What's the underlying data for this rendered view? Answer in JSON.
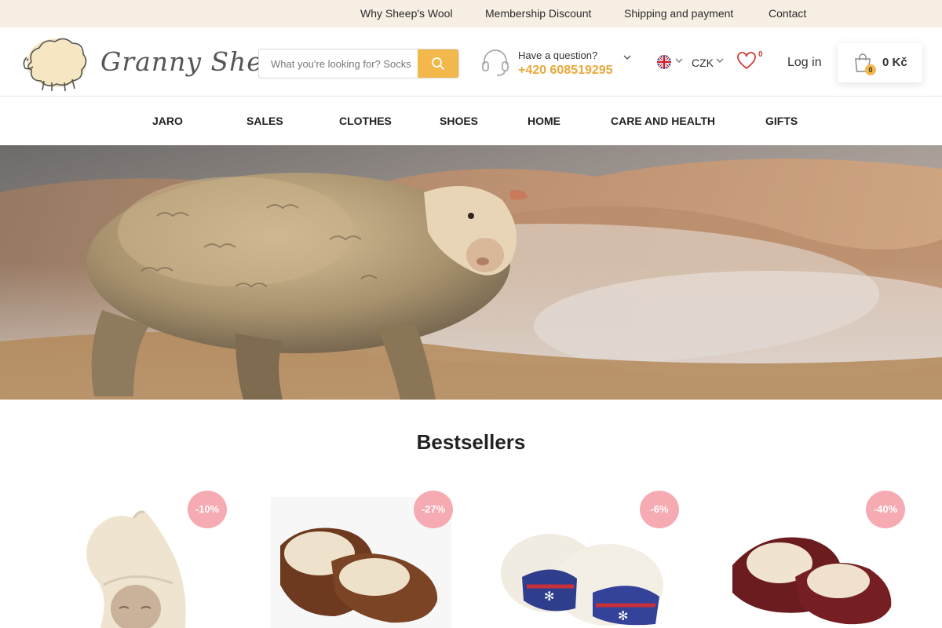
{
  "topbar": {
    "links": [
      "Why Sheep's Wool",
      "Membership Discount",
      "Shipping and payment",
      "Contact"
    ]
  },
  "header": {
    "logo_text": "Granny Sheep",
    "search": {
      "placeholder": "What you're looking for? Socks"
    },
    "help": {
      "question": "Have a question?",
      "phone": "+420 608519295"
    },
    "currency": "CZK",
    "wishlist_count": "0",
    "login_label": "Log in",
    "cart": {
      "count": "0",
      "total": "0 Kč"
    }
  },
  "nav": {
    "items": [
      "JARO",
      "SALES",
      "CLOTHES",
      "SHOES",
      "HOME",
      "CARE AND HEALTH",
      "GIFTS"
    ]
  },
  "bestsellers": {
    "title": "Bestsellers",
    "products": [
      {
        "discount": "-10%",
        "kind": "wool-hat"
      },
      {
        "discount": "-27%",
        "kind": "brown-slippers"
      },
      {
        "discount": "-6%",
        "kind": "nordic-slippers"
      },
      {
        "discount": "-40%",
        "kind": "burgundy-slippers"
      }
    ]
  },
  "colors": {
    "accent": "#f2b84b",
    "phone": "#e9a83b",
    "topbar_bg": "#f7efe3",
    "badge": "#f6aab2"
  }
}
